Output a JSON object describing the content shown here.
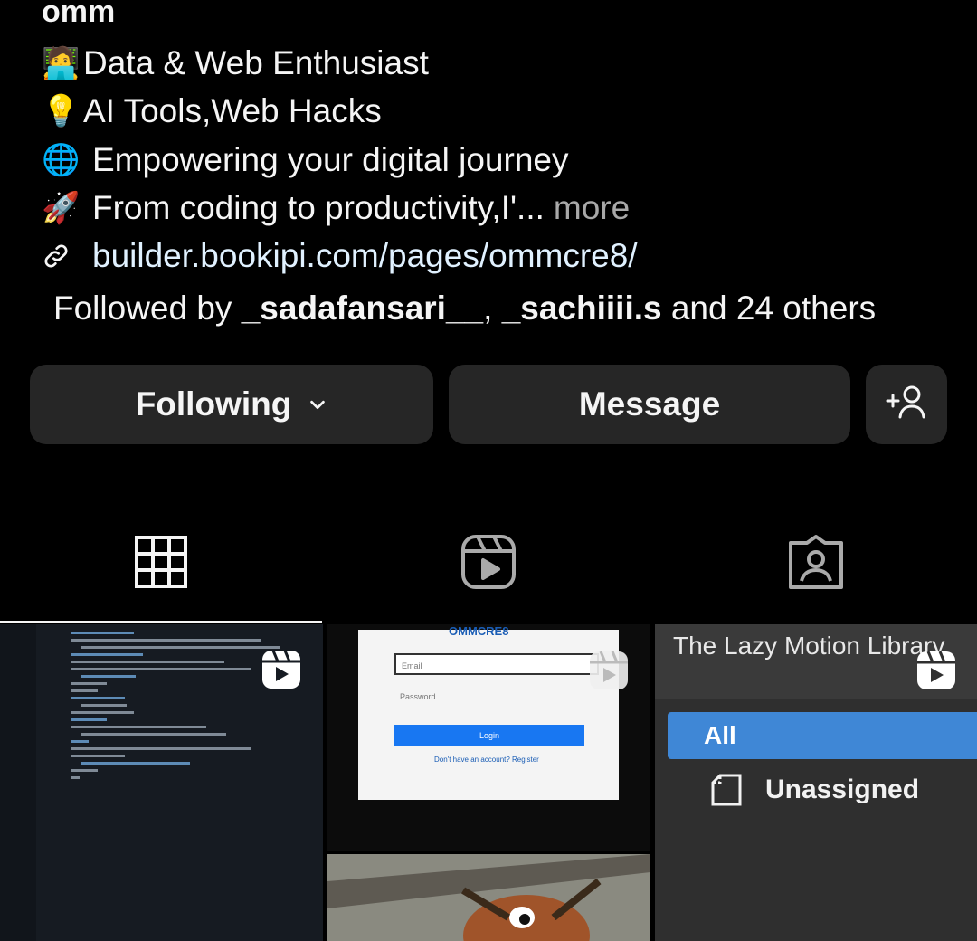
{
  "profile": {
    "name": "omm",
    "bio_lines": [
      {
        "icon": "technologist-emoji",
        "glyph": "🧑‍💻",
        "text": "Data & Web Enthusiast"
      },
      {
        "icon": "light-bulb-emoji",
        "glyph": "💡",
        "text": "AI Tools,Web Hacks"
      },
      {
        "icon": "globe-emoji",
        "glyph": "🌐",
        "text": "Empowering your digital journey"
      },
      {
        "icon": "rocket-emoji",
        "glyph": "🚀",
        "text": "From coding to productivity,I'...",
        "more": "more"
      }
    ],
    "link": {
      "icon": "link-icon",
      "text": "builder.bookipi.com/pages/ommcre8/"
    },
    "followed_by": {
      "prefix": "Followed by ",
      "user1": "_sadafansari__",
      "separator": ", ",
      "user2": "_sachiiii.s",
      "suffix": " and 24 others"
    }
  },
  "actions": {
    "following_label": "Following",
    "message_label": "Message",
    "add_user_icon": "add-person-icon"
  },
  "tabs": [
    {
      "name": "grid",
      "icon": "grid-icon",
      "active": true
    },
    {
      "name": "reels",
      "icon": "reels-icon",
      "active": false
    },
    {
      "name": "tagged",
      "icon": "tagged-icon",
      "active": false
    }
  ],
  "posts": {
    "post2": {
      "title": "OMMCRE8",
      "email_placeholder": "Email",
      "password_placeholder": "Password",
      "login_label": "Login",
      "register_text": "Don't have an account? Register"
    },
    "post3": {
      "title": "The Lazy Motion Library",
      "all_label": "All",
      "unassigned_label": "Unassigned"
    }
  },
  "colors": {
    "background": "#000000",
    "button": "#262626",
    "text": "#f5f5f5",
    "muted": "#a8a8a8"
  }
}
